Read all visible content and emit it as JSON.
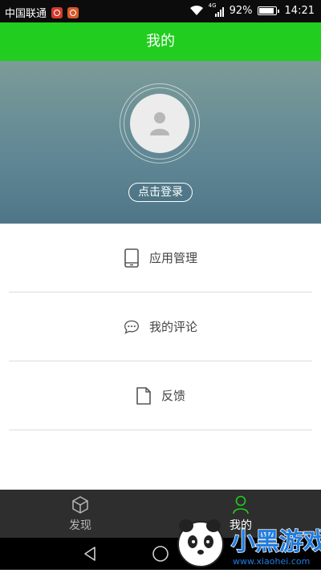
{
  "status_bar": {
    "carrier": "中国联通",
    "network_tag": "4G",
    "battery_percent": "92%",
    "battery_level": 0.92,
    "time": "14:21"
  },
  "header": {
    "title": "我的"
  },
  "profile": {
    "login_label": "点击登录"
  },
  "menu": {
    "items": [
      {
        "label": "应用管理",
        "icon": "phone-icon"
      },
      {
        "label": "我的评论",
        "icon": "comment-icon"
      },
      {
        "label": "反馈",
        "icon": "document-icon"
      }
    ]
  },
  "tab_bar": {
    "tabs": [
      {
        "label": "发现",
        "icon": "box-icon",
        "active": false
      },
      {
        "label": "我的",
        "icon": "user-icon",
        "active": true
      }
    ]
  },
  "watermark": {
    "text": "小黑游戏",
    "url": "www.xiaohei.com"
  },
  "colors": {
    "accent": "#21cd1f",
    "tab_bar_bg": "#2e2e2e",
    "profile_gradient_top": "#7c9b98",
    "profile_gradient_bottom": "#4f7688"
  }
}
